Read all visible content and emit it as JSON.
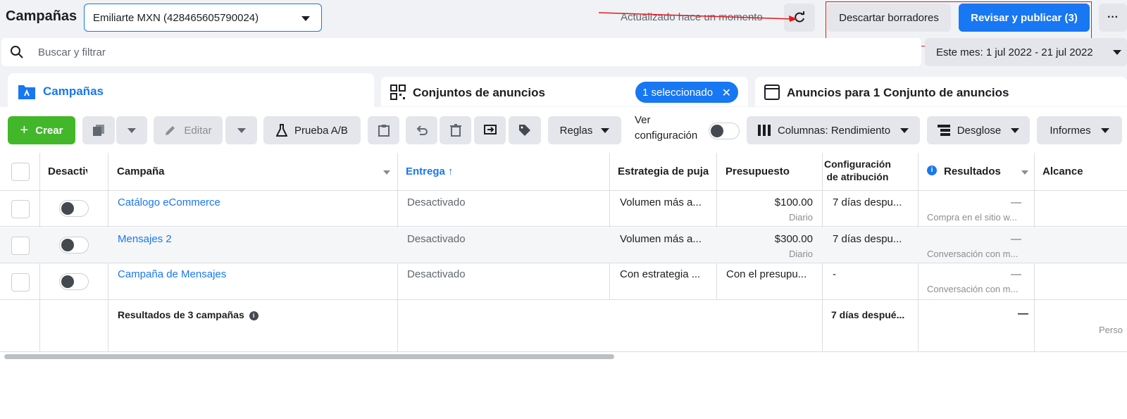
{
  "header": {
    "title": "Campañas",
    "account": "Emiliarte MXN (428465605790024)",
    "updated": "Actualizado hace un momento",
    "discard_label": "Descartar borradores",
    "publish_label": "Revisar y publicar (3)",
    "more_label": "···"
  },
  "search": {
    "placeholder": "Buscar y filtrar"
  },
  "date_range": "Este mes: 1 jul 2022 - 21 jul 2022",
  "tabs": [
    {
      "label": "Campañas"
    },
    {
      "label": "Conjuntos de anuncios",
      "badge": "1 seleccionado"
    },
    {
      "label": "Anuncios para 1 Conjunto de anuncios"
    }
  ],
  "toolbar": {
    "create": "Crear",
    "edit": "Editar",
    "ab_test": "Prueba A/B",
    "rules": "Reglas",
    "view_config_1": "Ver",
    "view_config_2": "configuración",
    "columns": "Columnas: Rendimiento",
    "breakdown": "Desglose",
    "reports": "Informes"
  },
  "columns": {
    "off": "Desactiv",
    "campaign": "Campaña",
    "delivery": "Entrega",
    "bid": "Estrategia de puja",
    "budget": "Presupuesto",
    "attr_1": "Configuración",
    "attr_2": "de atribución",
    "results": "Resultados",
    "reach": "Alcance"
  },
  "rows": [
    {
      "name": "Catálogo eCommerce",
      "delivery": "Desactivado",
      "bid": "Volumen más a...",
      "budget": "$100.00",
      "budget_sub": "Diario",
      "attr": "7 días despu...",
      "result": "—",
      "result_sub": "Compra en el sitio w..."
    },
    {
      "name": "Mensajes 2",
      "delivery": "Desactivado",
      "bid": "Volumen más a...",
      "budget": "$300.00",
      "budget_sub": "Diario",
      "attr": "7 días despu...",
      "result": "—",
      "result_sub": "Conversación con m..."
    },
    {
      "name": "Campaña de Mensajes",
      "delivery": "Desactivado",
      "bid": "Con estrategia ...",
      "budget": "Con el presupu...",
      "budget_sub": "",
      "attr": "-",
      "result": "—",
      "result_sub": "Conversación con m..."
    }
  ],
  "summary": {
    "label": "Resultados de 3 campañas",
    "attr": "7 días despué...",
    "result": "—",
    "reach_sub": "Perso"
  },
  "colors": {
    "accent": "#1877f2",
    "create": "#42b72a",
    "annotation": "#e21b1b"
  }
}
